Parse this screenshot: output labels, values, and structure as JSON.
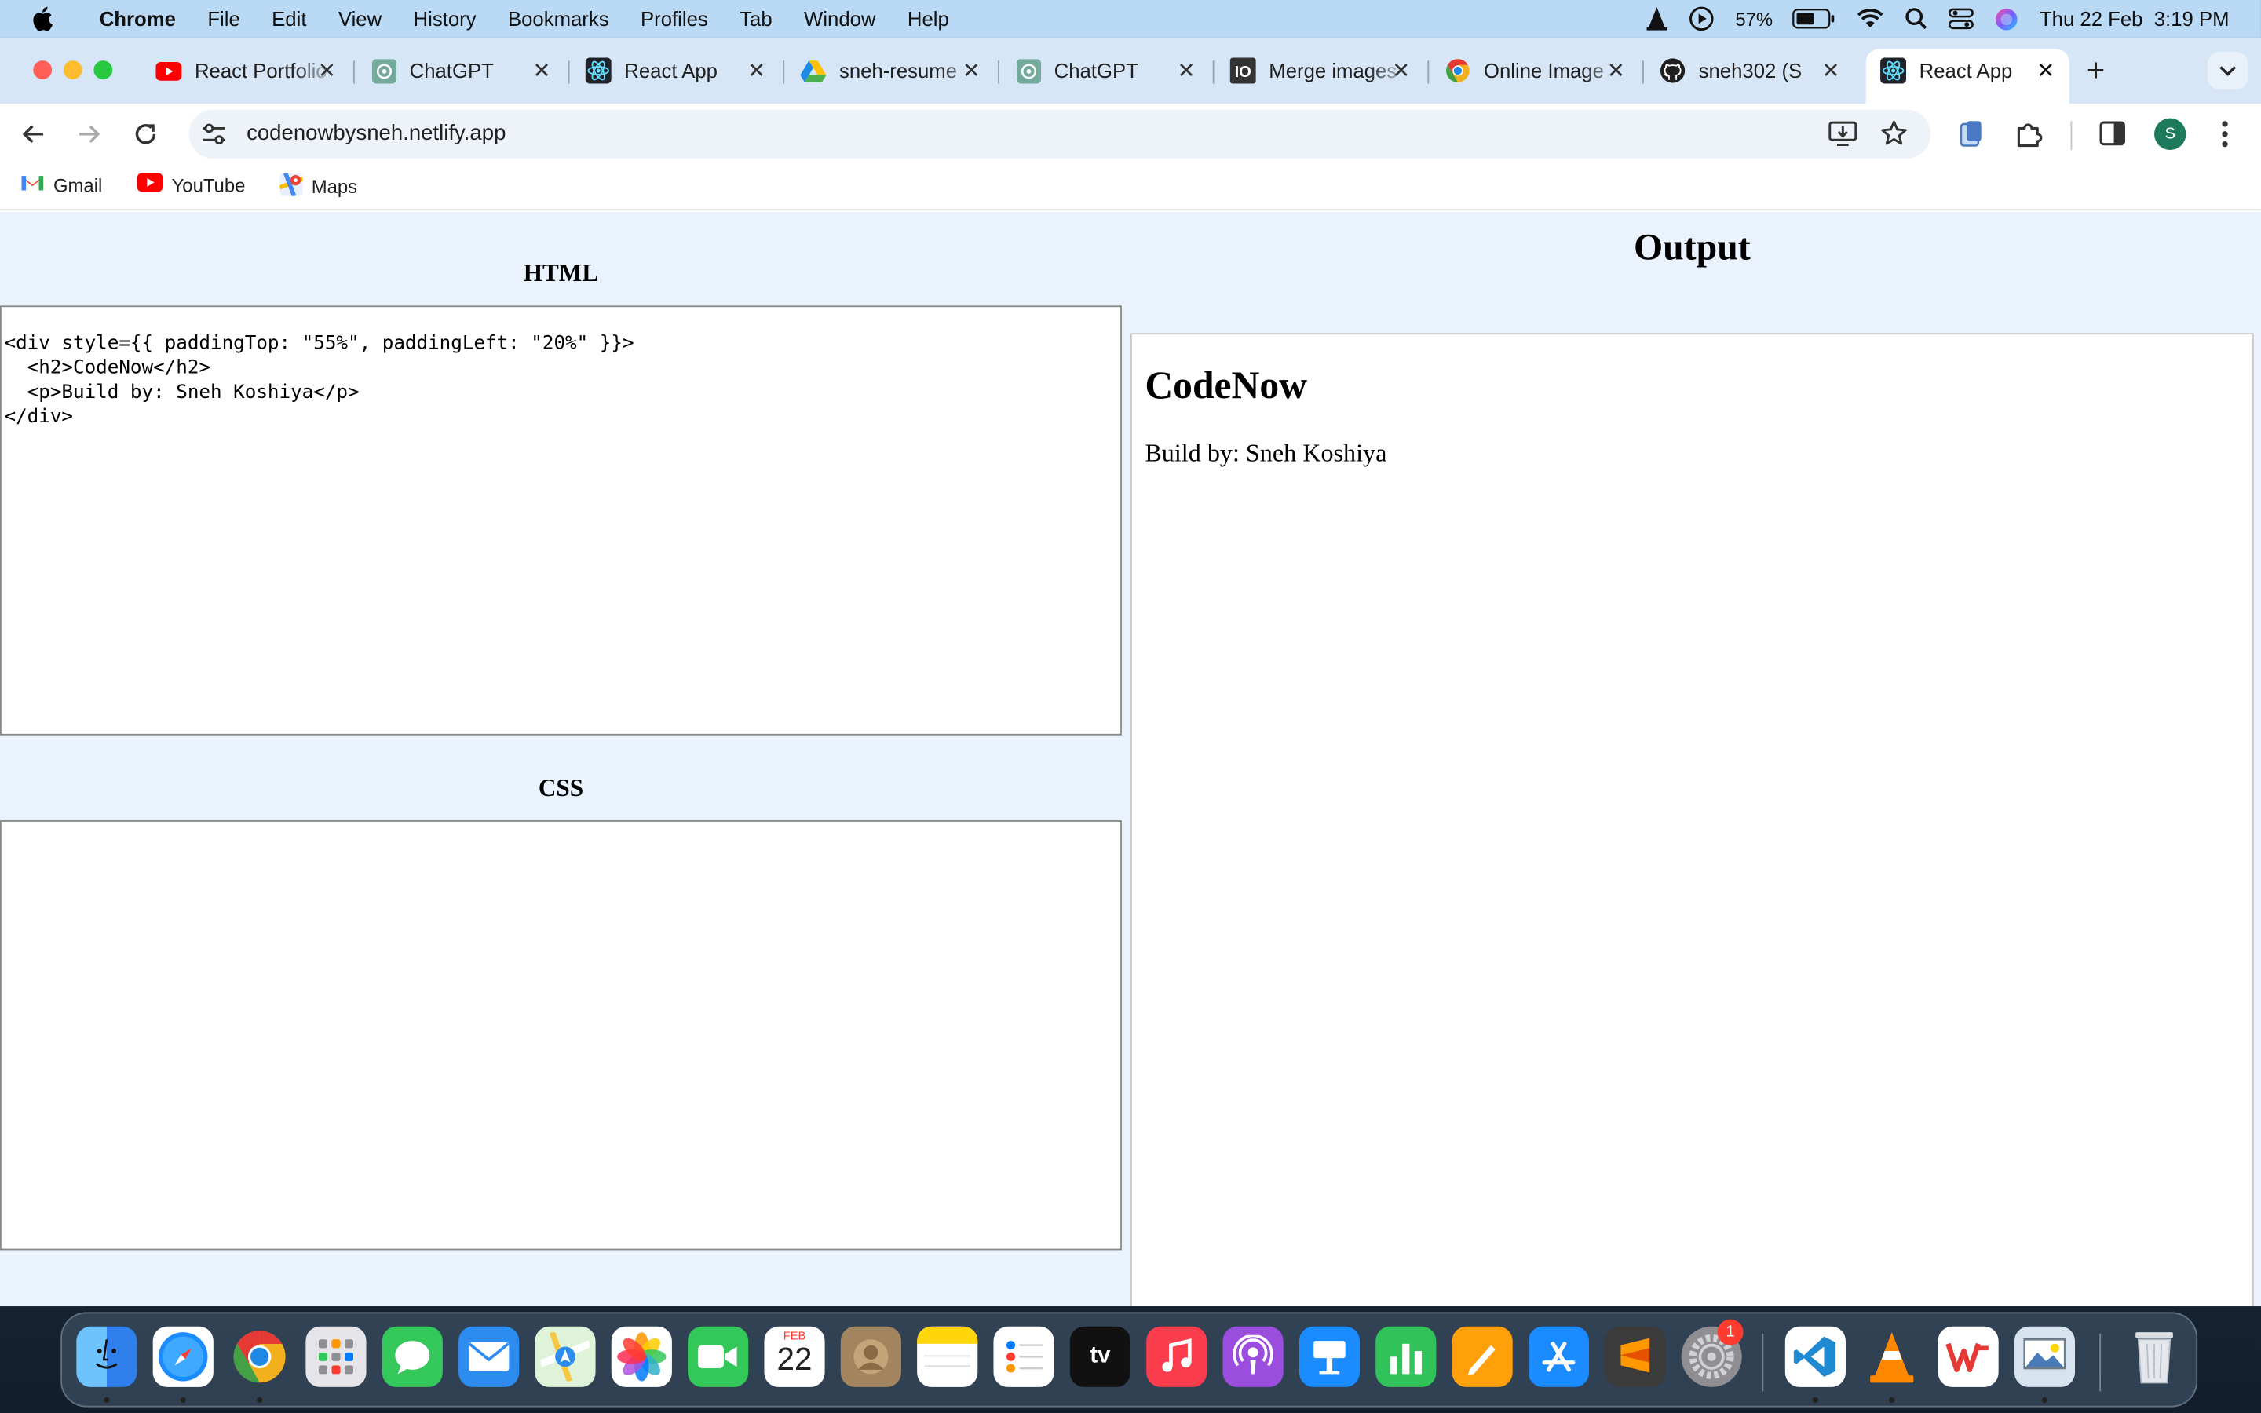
{
  "menubar": {
    "app": "Chrome",
    "menus": [
      "File",
      "Edit",
      "View",
      "History",
      "Bookmarks",
      "Profiles",
      "Tab",
      "Window",
      "Help"
    ],
    "battery": "57%",
    "datetime": "Thu 22 Feb  3:19 PM"
  },
  "tabs": [
    {
      "title": "React Portfolio",
      "icon": "youtube-icon"
    },
    {
      "title": "ChatGPT",
      "icon": "chatgpt-icon"
    },
    {
      "title": "React App",
      "icon": "react-icon"
    },
    {
      "title": "sneh-resume",
      "icon": "google-drive-icon"
    },
    {
      "title": "ChatGPT",
      "icon": "chatgpt-icon"
    },
    {
      "title": "Merge images",
      "icon": "io-icon"
    },
    {
      "title": "Online Image",
      "icon": "chrome-icon"
    },
    {
      "title": "sneh302 (S",
      "icon": "github-icon"
    },
    {
      "title": "React App",
      "icon": "react-icon",
      "active": true
    }
  ],
  "toolbar": {
    "url": "codenowbysneh.netlify.app"
  },
  "bookmarks": [
    {
      "label": "Gmail",
      "icon": "gmail-icon"
    },
    {
      "label": "YouTube",
      "icon": "youtube-icon"
    },
    {
      "label": "Maps",
      "icon": "maps-icon"
    }
  ],
  "editor": {
    "html_heading": "HTML",
    "html_code": "<div style={{ paddingTop: \"55%\", paddingLeft: \"20%\" }}>\n  <h2>CodeNow</h2>\n  <p>Build by: Sneh Koshiya</p>\n</div>",
    "css_heading": "CSS",
    "css_code": ""
  },
  "output": {
    "heading": "Output",
    "title": "CodeNow",
    "text": "Build by: Sneh Koshiya"
  },
  "dock": {
    "calendar_month": "FEB",
    "calendar_day": "22",
    "settings_badge": "1"
  },
  "colors": {
    "menubar": "#b9d9f4",
    "tabstrip": "#d6e6f6",
    "page_bg": "#eaf2fd"
  }
}
